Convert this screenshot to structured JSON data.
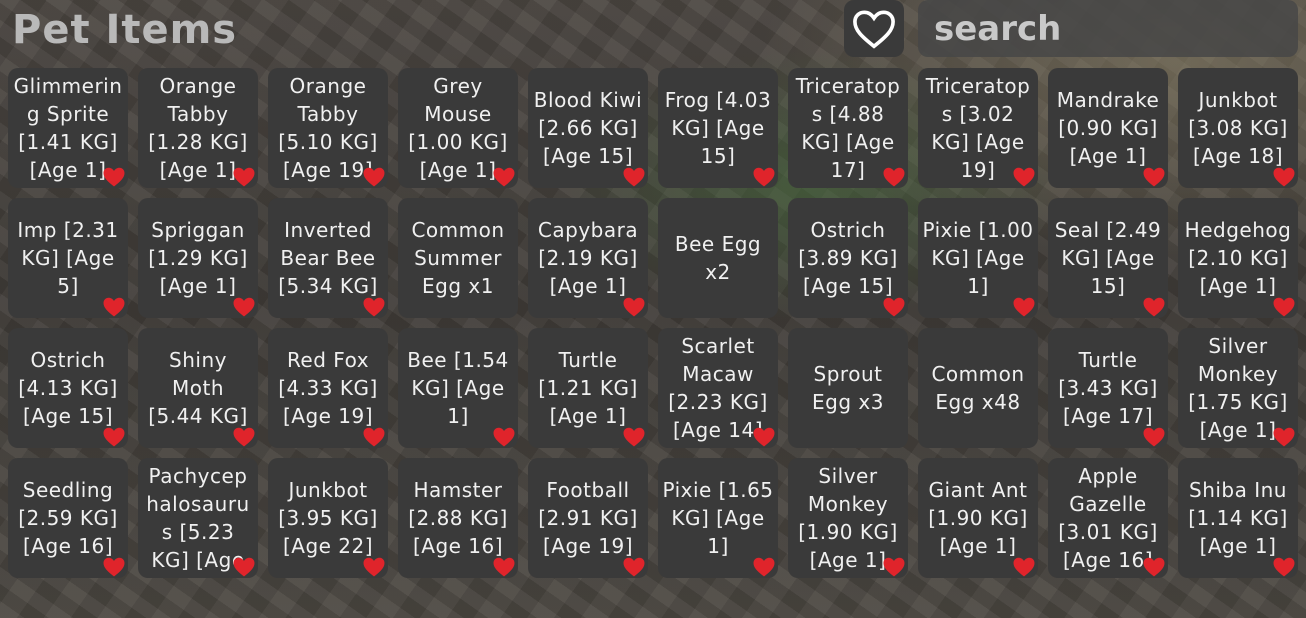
{
  "header": {
    "title": "Pet Items",
    "favorite_icon": "heart-outline-icon",
    "search_placeholder": "search"
  },
  "colors": {
    "heart": "#e0242b",
    "card": "#3a3a3a"
  },
  "items": [
    {
      "label": "Glimmering Sprite [1.41 KG] [Age 1]",
      "favorited": true
    },
    {
      "label": "Orange Tabby [1.28 KG] [Age 1]",
      "favorited": true
    },
    {
      "label": "Orange Tabby [5.10 KG] [Age 19]",
      "favorited": true
    },
    {
      "label": "Grey Mouse [1.00 KG] [Age 1]",
      "favorited": true
    },
    {
      "label": "Blood Kiwi [2.66 KG] [Age 15]",
      "favorited": true
    },
    {
      "label": "Frog [4.03 KG] [Age 15]",
      "favorited": true
    },
    {
      "label": "Triceratops [4.88 KG] [Age 17]",
      "favorited": true
    },
    {
      "label": "Triceratops [3.02 KG] [Age 19]",
      "favorited": true
    },
    {
      "label": "Mandrake [0.90 KG] [Age 1]",
      "favorited": true
    },
    {
      "label": "Junkbot [3.08 KG] [Age 18]",
      "favorited": true
    },
    {
      "label": "Imp [2.31 KG] [Age 5]",
      "favorited": true
    },
    {
      "label": "Spriggan [1.29 KG] [Age 1]",
      "favorited": true
    },
    {
      "label": "Inverted Bear Bee [5.34 KG]",
      "favorited": true
    },
    {
      "label": "Common Summer Egg x1",
      "favorited": false
    },
    {
      "label": "Capybara [2.19 KG] [Age 1]",
      "favorited": true
    },
    {
      "label": "Bee Egg x2",
      "favorited": false
    },
    {
      "label": "Ostrich [3.89 KG] [Age 15]",
      "favorited": true
    },
    {
      "label": "Pixie [1.00 KG] [Age 1]",
      "favorited": true
    },
    {
      "label": "Seal [2.49 KG] [Age 15]",
      "favorited": true
    },
    {
      "label": "Hedgehog [2.10 KG] [Age 1]",
      "favorited": true
    },
    {
      "label": "Ostrich [4.13 KG] [Age 15]",
      "favorited": true
    },
    {
      "label": "Shiny Moth [5.44 KG]",
      "favorited": true
    },
    {
      "label": "Red Fox [4.33 KG] [Age 19]",
      "favorited": true
    },
    {
      "label": "Bee [1.54 KG] [Age 1]",
      "favorited": true
    },
    {
      "label": "Turtle [1.21 KG] [Age 1]",
      "favorited": true
    },
    {
      "label": "Scarlet Macaw [2.23 KG] [Age 14]",
      "favorited": true
    },
    {
      "label": "Sprout Egg x3",
      "favorited": false
    },
    {
      "label": "Common Egg x48",
      "favorited": false
    },
    {
      "label": "Turtle [3.43 KG] [Age 17]",
      "favorited": true
    },
    {
      "label": "Silver Monkey [1.75 KG] [Age 1]",
      "favorited": true
    },
    {
      "label": "Seedling [2.59 KG] [Age 16]",
      "favorited": true
    },
    {
      "label": "Pachycephalosaurus [5.23 KG] [Age",
      "favorited": true
    },
    {
      "label": "Junkbot [3.95 KG] [Age 22]",
      "favorited": true
    },
    {
      "label": "Hamster [2.88 KG] [Age 16]",
      "favorited": true
    },
    {
      "label": "Football [2.91 KG] [Age 19]",
      "favorited": true
    },
    {
      "label": "Pixie [1.65 KG] [Age 1]",
      "favorited": true
    },
    {
      "label": "Silver Monkey [1.90 KG] [Age 1]",
      "favorited": true
    },
    {
      "label": "Giant Ant [1.90 KG] [Age 1]",
      "favorited": true
    },
    {
      "label": "Apple Gazelle [3.01 KG] [Age 16]",
      "favorited": true
    },
    {
      "label": "Shiba Inu [1.14 KG] [Age 1]",
      "favorited": true
    }
  ]
}
